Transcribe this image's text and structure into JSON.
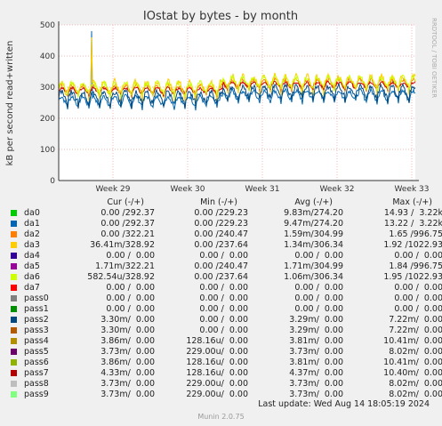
{
  "chart_data": {
    "type": "line",
    "title": "IOstat by bytes - by month",
    "ylabel": "kB per second read+written",
    "side_label": "RRDTOOL / TOBI OETIKER",
    "ylim": [
      0,
      500
    ],
    "yticks": [
      0,
      100,
      200,
      300,
      400,
      500
    ],
    "xticks": [
      "Week 29",
      "Week 30",
      "Week 31",
      "Week 32",
      "Week 33"
    ],
    "series": [
      {
        "name": "da1",
        "color": "#0066b3",
        "baseline": 258,
        "amp": 25,
        "spike": 480
      },
      {
        "name": "da3",
        "color": "#ffcc00",
        "baseline": 300,
        "amp": 35,
        "spike": 460
      },
      {
        "name": "da2",
        "color": "#ff8000",
        "baseline": 295,
        "amp": 22
      },
      {
        "name": "pass7",
        "color": "#cc0000",
        "baseline": 290,
        "amp": 15
      },
      {
        "name": "da6",
        "color": "#ccff00",
        "baseline": 300,
        "amp": 28
      },
      {
        "name": "pass2",
        "color": "#00487d",
        "baseline": 270,
        "amp": 30
      }
    ]
  },
  "legend": {
    "headers": {
      "cur": "Cur (-/+)",
      "min": "Min (-/+)",
      "avg": "Avg (-/+)",
      "max": "Max (-/+)"
    },
    "rows": [
      {
        "name": "da0",
        "color": "#00cc00",
        "cur": "0.00 /292.37",
        "min": "0.00 /229.23",
        "avg": "9.83m/274.20",
        "max": "14.93 /  3.22k"
      },
      {
        "name": "da1",
        "color": "#0066b3",
        "cur": "0.00 /292.37",
        "min": "0.00 /229.23",
        "avg": "9.47m/274.20",
        "max": "13.22 /  3.22k"
      },
      {
        "name": "da2",
        "color": "#ff8000",
        "cur": "0.00 /322.21",
        "min": "0.00 /240.47",
        "avg": "1.59m/304.99",
        "max": "1.65 /996.75"
      },
      {
        "name": "da3",
        "color": "#ffcc00",
        "cur": "36.41m/328.92",
        "min": "0.00 /237.64",
        "avg": "1.34m/306.34",
        "max": "1.92 /1022.93"
      },
      {
        "name": "da4",
        "color": "#330099",
        "cur": "0.00 /  0.00",
        "min": "0.00 /  0.00",
        "avg": "0.00 /  0.00",
        "max": "0.00 /  0.00"
      },
      {
        "name": "da5",
        "color": "#990099",
        "cur": "1.71m/322.21",
        "min": "0.00 /240.47",
        "avg": "1.71m/304.99",
        "max": "1.84 /996.75"
      },
      {
        "name": "da6",
        "color": "#ccff00",
        "cur": "582.54u/328.92",
        "min": "0.00 /237.64",
        "avg": "1.06m/306.34",
        "max": "1.95 /1022.93"
      },
      {
        "name": "da7",
        "color": "#ff0000",
        "cur": "0.00 /  0.00",
        "min": "0.00 /  0.00",
        "avg": "0.00 /  0.00",
        "max": "0.00 /  0.00"
      },
      {
        "name": "pass0",
        "color": "#808080",
        "cur": "0.00 /  0.00",
        "min": "0.00 /  0.00",
        "avg": "0.00 /  0.00",
        "max": "0.00 /  0.00"
      },
      {
        "name": "pass1",
        "color": "#008f00",
        "cur": "0.00 /  0.00",
        "min": "0.00 /  0.00",
        "avg": "0.00 /  0.00",
        "max": "0.00 /  0.00"
      },
      {
        "name": "pass2",
        "color": "#00487d",
        "cur": "3.30m/  0.00",
        "min": "0.00 /  0.00",
        "avg": "3.29m/  0.00",
        "max": "7.22m/  0.00"
      },
      {
        "name": "pass3",
        "color": "#b35a00",
        "cur": "3.30m/  0.00",
        "min": "0.00 /  0.00",
        "avg": "3.29m/  0.00",
        "max": "7.22m/  0.00"
      },
      {
        "name": "pass4",
        "color": "#b38f00",
        "cur": "3.86m/  0.00",
        "min": "128.16u/  0.00",
        "avg": "3.81m/  0.00",
        "max": "10.41m/  0.00"
      },
      {
        "name": "pass5",
        "color": "#6b006b",
        "cur": "3.73m/  0.00",
        "min": "229.00u/  0.00",
        "avg": "3.73m/  0.00",
        "max": "8.02m/  0.00"
      },
      {
        "name": "pass6",
        "color": "#8fb300",
        "cur": "3.86m/  0.00",
        "min": "128.16u/  0.00",
        "avg": "3.81m/  0.00",
        "max": "10.41m/  0.00"
      },
      {
        "name": "pass7",
        "color": "#b30000",
        "cur": "4.33m/  0.00",
        "min": "128.16u/  0.00",
        "avg": "4.37m/  0.00",
        "max": "10.40m/  0.00"
      },
      {
        "name": "pass8",
        "color": "#bebebe",
        "cur": "3.73m/  0.00",
        "min": "229.00u/  0.00",
        "avg": "3.73m/  0.00",
        "max": "8.02m/  0.00"
      },
      {
        "name": "pass9",
        "color": "#80ff80",
        "cur": "3.73m/  0.00",
        "min": "229.00u/  0.00",
        "avg": "3.73m/  0.00",
        "max": "8.02m/  0.00"
      }
    ],
    "last_update": "Last update:  Wed Aug 14 18:05:19 2024",
    "version": "Munin 2.0.75"
  }
}
